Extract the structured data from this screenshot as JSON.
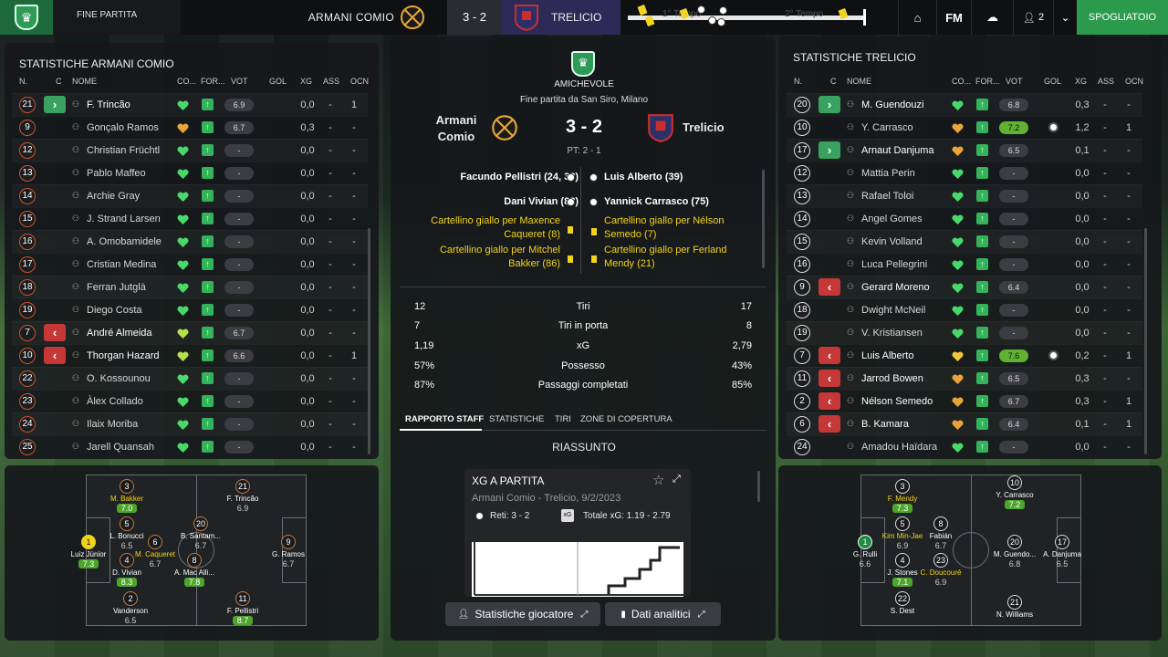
{
  "topbar": {
    "status": "FINE PARTITA",
    "home_team": "ARMANI COMIO",
    "score": "3 - 2",
    "away_team": "TRELICIO",
    "half1": "1° Tempo",
    "half2": "2° Tempo",
    "fm": "FM",
    "people_count": "2",
    "dressing_room": "SPOGLIATOIO"
  },
  "colors": {
    "accent_green": "#2c9a4d",
    "sub_in": "#3aa260",
    "sub_out": "#c63737",
    "yellow": "#f2d31b"
  },
  "left": {
    "title": "STATISTICHE ARMANI COMIO",
    "headers": {
      "n": "N.",
      "c": "C",
      "name": "NOME",
      "co": "CO...",
      "for": "FOR...",
      "vot": "VOT",
      "gol": "GOL",
      "xg": "XG",
      "ass": "ASS",
      "ocn": "OCN"
    },
    "players": [
      {
        "num": "21",
        "sub": "in",
        "name": "F. Trincão",
        "vote": "6.9",
        "gol": "",
        "xg": "0,0",
        "ass": "-",
        "ocn": "1",
        "heart": "green"
      },
      {
        "num": "9",
        "sub": "",
        "name": "Gonçalo Ramos",
        "vote": "6.7",
        "gol": "",
        "xg": "0,3",
        "ass": "-",
        "ocn": "-",
        "heart": "orange"
      },
      {
        "num": "12",
        "sub": "",
        "name": "Christian Früchtl",
        "vote": "-",
        "gol": "",
        "xg": "0,0",
        "ass": "-",
        "ocn": "-",
        "heart": "green"
      },
      {
        "num": "13",
        "sub": "",
        "name": "Pablo Maffeo",
        "vote": "-",
        "gol": "",
        "xg": "0,0",
        "ass": "-",
        "ocn": "-",
        "heart": "green"
      },
      {
        "num": "14",
        "sub": "",
        "name": "Archie Gray",
        "vote": "-",
        "gol": "",
        "xg": "0,0",
        "ass": "-",
        "ocn": "-",
        "heart": "green"
      },
      {
        "num": "15",
        "sub": "",
        "name": "J. Strand Larsen",
        "vote": "-",
        "gol": "",
        "xg": "0,0",
        "ass": "-",
        "ocn": "-",
        "heart": "green"
      },
      {
        "num": "16",
        "sub": "",
        "name": "A. Omobamidele",
        "vote": "-",
        "gol": "",
        "xg": "0,0",
        "ass": "-",
        "ocn": "-",
        "heart": "green"
      },
      {
        "num": "17",
        "sub": "",
        "name": "Cristian Medina",
        "vote": "-",
        "gol": "",
        "xg": "0,0",
        "ass": "-",
        "ocn": "-",
        "heart": "green"
      },
      {
        "num": "18",
        "sub": "",
        "name": "Ferran Jutglà",
        "vote": "-",
        "gol": "",
        "xg": "0,0",
        "ass": "-",
        "ocn": "-",
        "heart": "green"
      },
      {
        "num": "19",
        "sub": "",
        "name": "Diego Costa",
        "vote": "-",
        "gol": "",
        "xg": "0,0",
        "ass": "-",
        "ocn": "-",
        "heart": "green"
      },
      {
        "num": "7",
        "sub": "out",
        "name": "André Almeida",
        "vote": "6.7",
        "gol": "",
        "xg": "0,0",
        "ass": "-",
        "ocn": "-",
        "heart": "lime"
      },
      {
        "num": "10",
        "sub": "out",
        "name": "Thorgan Hazard",
        "vote": "6.6",
        "gol": "",
        "xg": "0,0",
        "ass": "-",
        "ocn": "1",
        "heart": "lime"
      },
      {
        "num": "22",
        "sub": "",
        "name": "O. Kossounou",
        "vote": "-",
        "gol": "",
        "xg": "0,0",
        "ass": "-",
        "ocn": "-",
        "heart": "green"
      },
      {
        "num": "23",
        "sub": "",
        "name": "Àlex Collado",
        "vote": "-",
        "gol": "",
        "xg": "0,0",
        "ass": "-",
        "ocn": "-",
        "heart": "green"
      },
      {
        "num": "24",
        "sub": "",
        "name": "Ilaix Moriba",
        "vote": "-",
        "gol": "",
        "xg": "0,0",
        "ass": "-",
        "ocn": "-",
        "heart": "green"
      },
      {
        "num": "25",
        "sub": "",
        "name": "Jarell Quansah",
        "vote": "-",
        "gol": "",
        "xg": "0,0",
        "ass": "-",
        "ocn": "-",
        "heart": "green"
      }
    ],
    "pitch": [
      {
        "num": "3",
        "name": "M. Bakker",
        "vote": "7.0",
        "yel": true,
        "g": true
      },
      {
        "num": "21",
        "name": "F. Trincão",
        "vote": "6.9",
        "yel": false,
        "g": false
      },
      {
        "num": "5",
        "name": "L. Bonucci",
        "vote": "6.5",
        "yel": false,
        "g": false
      },
      {
        "num": "20",
        "name": "B. Santam...",
        "vote": "6.7",
        "yel": false,
        "g": false
      },
      {
        "num": "6",
        "name": "M. Caqueret",
        "vote": "6.7",
        "yel": true,
        "g": false
      },
      {
        "num": "1",
        "name": "Luiz Júnior",
        "vote": "7.3",
        "yel": false,
        "g": true
      },
      {
        "num": "9",
        "name": "G. Ramos",
        "vote": "6.7",
        "yel": false,
        "g": false
      },
      {
        "num": "4",
        "name": "D. Vivian",
        "vote": "8.3",
        "yel": false,
        "g": true
      },
      {
        "num": "8",
        "name": "A. Mac Alli...",
        "vote": "7.8",
        "yel": false,
        "g": true
      },
      {
        "num": "2",
        "name": "Vanderson",
        "vote": "6.5",
        "yel": false,
        "g": false
      },
      {
        "num": "11",
        "name": "F. Pellistri",
        "vote": "8.7",
        "yel": false,
        "g": true
      }
    ]
  },
  "center": {
    "competition": "AMICHEVOLE",
    "venue": "Fine partita da San Siro, Milano",
    "home": "Armani Comio",
    "away": "Trelicio",
    "score": "3 - 2",
    "ht": "PT: 2 - 1",
    "home_events": [
      "Facundo Pellistri (24, 33)",
      "Dani Vivian (83)"
    ],
    "away_events": [
      "Luis Alberto (39)",
      "Yannick Carrasco (75)"
    ],
    "home_cards": [
      "Cartellino giallo per Maxence Caqueret (8)",
      "Cartellino giallo per Mitchel Bakker (86)"
    ],
    "away_cards": [
      "Cartellino giallo per Nélson Semedo (7)",
      "Cartellino giallo per Ferland Mendy (21)"
    ],
    "stats": [
      {
        "label": "Tiri",
        "home": "12",
        "away": "17"
      },
      {
        "label": "Tiri in porta",
        "home": "7",
        "away": "8"
      },
      {
        "label": "xG",
        "home": "1,19",
        "away": "2,79"
      },
      {
        "label": "Possesso",
        "home": "57%",
        "away": "43%"
      },
      {
        "label": "Passaggi completati",
        "home": "87%",
        "away": "85%"
      }
    ],
    "tabs": [
      "RAPPORTO STAFF",
      "STATISTICHE",
      "TIRI",
      "ZONE DI COPERTURA"
    ],
    "summary": "RIASSUNTO",
    "card_title": "XG A PARTITA",
    "card_sub": "Armani Comio - Trelicio, 9/2/2023",
    "goals": "Reti: 3 - 2",
    "total_xg": "Totale xG: 1.19 - 2.79",
    "btn_players": "Statistiche giocatore",
    "btn_analytics": "Dati analitici"
  },
  "right": {
    "title": "STATISTICHE TRELICIO",
    "players": [
      {
        "num": "20",
        "sub": "in",
        "name": "M. Guendouzi",
        "vote": "6.8",
        "ball": false,
        "xg": "0,3",
        "ass": "-",
        "ocn": "-",
        "heart": "green"
      },
      {
        "num": "10",
        "sub": "",
        "name": "Y. Carrasco",
        "vote": "7.2",
        "ball": true,
        "xg": "1,2",
        "ass": "-",
        "ocn": "1",
        "heart": "orange"
      },
      {
        "num": "17",
        "sub": "in",
        "name": "Arnaut Danjuma",
        "vote": "6.5",
        "ball": false,
        "xg": "0,1",
        "ass": "-",
        "ocn": "-",
        "heart": "orange"
      },
      {
        "num": "12",
        "sub": "",
        "name": "Mattia Perin",
        "vote": "-",
        "ball": false,
        "xg": "0,0",
        "ass": "-",
        "ocn": "-",
        "heart": "green"
      },
      {
        "num": "13",
        "sub": "",
        "name": "Rafael Toloi",
        "vote": "-",
        "ball": false,
        "xg": "0,0",
        "ass": "-",
        "ocn": "-",
        "heart": "green"
      },
      {
        "num": "14",
        "sub": "",
        "name": "Angel Gomes",
        "vote": "-",
        "ball": false,
        "xg": "0,0",
        "ass": "-",
        "ocn": "-",
        "heart": "green"
      },
      {
        "num": "15",
        "sub": "",
        "name": "Kevin Volland",
        "vote": "-",
        "ball": false,
        "xg": "0,0",
        "ass": "-",
        "ocn": "-",
        "heart": "green"
      },
      {
        "num": "16",
        "sub": "",
        "name": "Luca Pellegrini",
        "vote": "-",
        "ball": false,
        "xg": "0,0",
        "ass": "-",
        "ocn": "-",
        "heart": "green"
      },
      {
        "num": "9",
        "sub": "out",
        "name": "Gerard Moreno",
        "vote": "6.4",
        "ball": false,
        "xg": "0,0",
        "ass": "-",
        "ocn": "-",
        "heart": "green"
      },
      {
        "num": "18",
        "sub": "",
        "name": "Dwight McNeil",
        "vote": "-",
        "ball": false,
        "xg": "0,0",
        "ass": "-",
        "ocn": "-",
        "heart": "green"
      },
      {
        "num": "19",
        "sub": "",
        "name": "V. Kristiansen",
        "vote": "-",
        "ball": false,
        "xg": "0,0",
        "ass": "-",
        "ocn": "-",
        "heart": "green"
      },
      {
        "num": "7",
        "sub": "out",
        "name": "Luis Alberto",
        "vote": "7.6",
        "ball": true,
        "xg": "0,2",
        "ass": "-",
        "ocn": "1",
        "heart": "yellow"
      },
      {
        "num": "11",
        "sub": "out",
        "name": "Jarrod Bowen",
        "vote": "6.5",
        "ball": false,
        "xg": "0,3",
        "ass": "-",
        "ocn": "-",
        "heart": "orange"
      },
      {
        "num": "2",
        "sub": "out",
        "name": "Nélson Semedo",
        "vote": "6.7",
        "ball": false,
        "xg": "0,3",
        "ass": "-",
        "ocn": "1",
        "heart": "orange"
      },
      {
        "num": "6",
        "sub": "out",
        "name": "B. Kamara",
        "vote": "6.4",
        "ball": false,
        "xg": "0,1",
        "ass": "-",
        "ocn": "1",
        "heart": "orange"
      },
      {
        "num": "24",
        "sub": "",
        "name": "Amadou Haïdara",
        "vote": "-",
        "ball": false,
        "xg": "0,0",
        "ass": "-",
        "ocn": "-",
        "heart": "green"
      }
    ],
    "pitch": [
      {
        "num": "3",
        "name": "F. Mendy",
        "vote": "7.3",
        "yel": true,
        "g": true
      },
      {
        "num": "10",
        "name": "Y. Carrasco",
        "vote": "7.2",
        "yel": false,
        "g": true
      },
      {
        "num": "5",
        "name": "Kim Min-Jae",
        "vote": "6.9",
        "yel": true,
        "g": false
      },
      {
        "num": "8",
        "name": "Fabián",
        "vote": "6.7",
        "yel": false,
        "g": false
      },
      {
        "num": "1",
        "name": "G. Rulli",
        "vote": "6.6",
        "yel": false,
        "g": false
      },
      {
        "num": "20",
        "name": "M. Guendo...",
        "vote": "6.8",
        "yel": false,
        "g": false
      },
      {
        "num": "17",
        "name": "A. Danjuma",
        "vote": "6.5",
        "yel": false,
        "g": false
      },
      {
        "num": "4",
        "name": "J. Stones",
        "vote": "7.1",
        "yel": false,
        "g": true
      },
      {
        "num": "23",
        "name": "C. Doucouré",
        "vote": "6.9",
        "yel": true,
        "g": false
      },
      {
        "num": "22",
        "name": "S. Dest",
        "vote": "",
        "yel": false,
        "g": false
      },
      {
        "num": "21",
        "name": "N. Williams",
        "vote": "",
        "yel": false,
        "g": false
      }
    ]
  }
}
